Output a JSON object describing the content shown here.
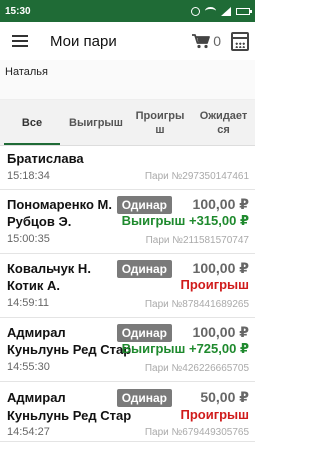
{
  "statusbar": {
    "time": "15:30"
  },
  "appbar": {
    "title": "Мои пари",
    "cart_count": "0"
  },
  "user": {
    "name": "Наталья"
  },
  "tabs": [
    {
      "label": "Все",
      "active": true
    },
    {
      "label": "Выигрыш",
      "active": false
    },
    {
      "label": "Проигры\nш",
      "active": false
    },
    {
      "label": "Ожидает\nся",
      "active": false
    }
  ],
  "bets": [
    {
      "event_line1": "Братислава",
      "time": "15:18:34",
      "number": "Пари №297350147461"
    },
    {
      "event_line1": "Пономаренко М.",
      "event_line2": "Рубцов Э.",
      "type": "Одинар",
      "amount": "100,00 ₽",
      "result": "Выигрыш +315,00 ₽",
      "time": "15:00:35",
      "number": "Пари №211581570747"
    },
    {
      "event_line1": "Ковальчук Н.",
      "event_line2": "Котик А.",
      "type": "Одинар",
      "amount": "100,00 ₽",
      "result": "Проигрыш",
      "time": "14:59:11",
      "number": "Пари №878441689265"
    },
    {
      "event_line1": "Адмирал",
      "event_line2": "Куньлунь Ред Стар",
      "type": "Одинар",
      "amount": "100,00 ₽",
      "result": "Выигрыш +725,00 ₽",
      "time": "14:55:30",
      "number": "Пари №426226665705"
    },
    {
      "event_line1": "Адмирал",
      "event_line2": "Куньлунь Ред Стар",
      "type": "Одинар",
      "amount": "50,00 ₽",
      "result": "Проигрыш",
      "time": "14:54:27",
      "number": "Пари №679449305765"
    }
  ],
  "colors": {
    "statusbar": "#1f6b36",
    "won": "#1f8a2e",
    "lost": "#d01b1b",
    "badge": "#7a7a7a"
  }
}
